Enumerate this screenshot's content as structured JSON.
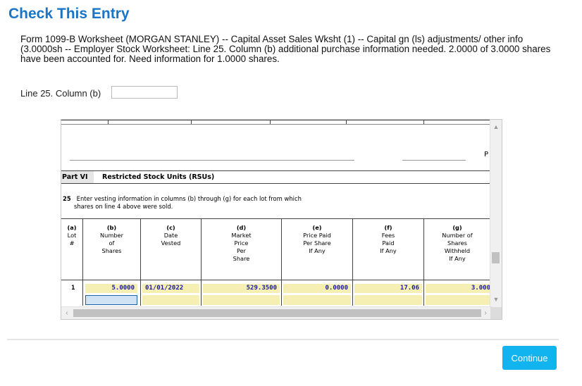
{
  "title": "Check This Entry",
  "message": "Form 1099-B Worksheet (MORGAN STANLEY) -- Capital Asset Sales Wksht (1) -- Capital gn (ls) adjustments/ other info (3.0000sh                          -- Employer Stock Worksheet: Line 25. Column (b) additional purchase information needed. 2.0000 of 3.0000 shares have been accounted for. Need information for 1.0000 shares.",
  "field": {
    "label": "Line 25. Column (b)",
    "value": ""
  },
  "form": {
    "p_char": "P",
    "part_label": "Part VI",
    "part_title": "Restricted Stock Units (RSUs)",
    "line_number": "25",
    "instruction_line1": "Enter vesting information in columns (b) through (g) for each lot from which",
    "instruction_line2": "shares on line 4 above were sold.",
    "columns": [
      {
        "letter": "(a)",
        "text": "Lot\n#"
      },
      {
        "letter": "(b)",
        "text": "Number\nof\nShares"
      },
      {
        "letter": "(c)",
        "text": "Date\nVested"
      },
      {
        "letter": "(d)",
        "text": "Market\nPrice\nPer\nShare"
      },
      {
        "letter": "(e)",
        "text": "Price Paid\nPer Share\nIf Any"
      },
      {
        "letter": "(f)",
        "text": "Fees\nPaid\nIf Any"
      },
      {
        "letter": "(g)",
        "text": "Number of\nShares\nWithheld\nIf Any"
      }
    ],
    "row": {
      "lot": "1",
      "number_of_shares": "5.0000",
      "date_vested": "01/01/2022",
      "market_price": "529.3500",
      "price_paid": "0.0000",
      "fees_paid": "17.06",
      "shares_withheld": "3.000"
    }
  },
  "button": {
    "continue": "Continue"
  },
  "colors": {
    "title": "#1a75c9",
    "button": "#12b4ef",
    "field_fill": "#f5efb3",
    "field_text": "#1a1aa6"
  },
  "icons": [
    "scroll-up-arrow-icon",
    "scroll-down-arrow-icon",
    "scroll-left-arrow-icon",
    "scroll-right-arrow-icon"
  ]
}
